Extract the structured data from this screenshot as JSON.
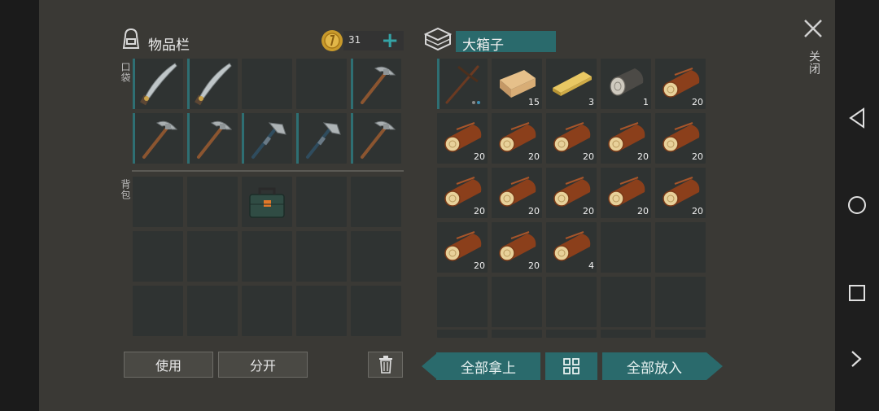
{
  "inventory": {
    "title": "物品栏",
    "pocket_label": "口袋",
    "backpack_label": "背包",
    "coins": "31",
    "add_symbol": "+"
  },
  "chest": {
    "title": "大箱子"
  },
  "pocket_slots": [
    {
      "item": "machete",
      "count": ""
    },
    {
      "item": "machete",
      "count": ""
    },
    {
      "item": "empty",
      "count": ""
    },
    {
      "item": "empty",
      "count": ""
    },
    {
      "item": "pickaxe",
      "count": ""
    },
    {
      "item": "pickaxe",
      "count": ""
    },
    {
      "item": "pickaxe",
      "count": ""
    },
    {
      "item": "hatchet",
      "count": ""
    },
    {
      "item": "hatchet",
      "count": ""
    },
    {
      "item": "pickaxe",
      "count": ""
    }
  ],
  "backpack_slots": [
    {
      "item": "empty"
    },
    {
      "item": "empty"
    },
    {
      "item": "toolbox"
    },
    {
      "item": "empty"
    },
    {
      "item": "empty"
    },
    {
      "item": "empty"
    },
    {
      "item": "empty"
    },
    {
      "item": "empty"
    },
    {
      "item": "empty"
    },
    {
      "item": "empty"
    },
    {
      "item": "empty"
    },
    {
      "item": "empty"
    },
    {
      "item": "empty"
    },
    {
      "item": "empty"
    },
    {
      "item": "empty"
    }
  ],
  "chest_slots": [
    {
      "item": "crowbar-pickaxe",
      "count": ""
    },
    {
      "item": "wooden-plank",
      "count": "15"
    },
    {
      "item": "board",
      "count": "3"
    },
    {
      "item": "gray-log",
      "count": "1"
    },
    {
      "item": "log",
      "count": "20"
    },
    {
      "item": "log",
      "count": "20"
    },
    {
      "item": "log",
      "count": "20"
    },
    {
      "item": "log",
      "count": "20"
    },
    {
      "item": "log",
      "count": "20"
    },
    {
      "item": "log",
      "count": "20"
    },
    {
      "item": "log",
      "count": "20"
    },
    {
      "item": "log",
      "count": "20"
    },
    {
      "item": "log",
      "count": "20"
    },
    {
      "item": "log",
      "count": "20"
    },
    {
      "item": "log",
      "count": "20"
    },
    {
      "item": "log",
      "count": "20"
    },
    {
      "item": "log",
      "count": "20"
    },
    {
      "item": "log",
      "count": "4"
    },
    {
      "item": "empty",
      "count": ""
    },
    {
      "item": "empty",
      "count": ""
    },
    {
      "item": "empty",
      "count": ""
    },
    {
      "item": "empty",
      "count": ""
    },
    {
      "item": "empty",
      "count": ""
    },
    {
      "item": "empty",
      "count": ""
    },
    {
      "item": "empty",
      "count": ""
    }
  ],
  "buttons": {
    "use": "使用",
    "split": "分开",
    "take_all": "全部拿上",
    "put_all": "全部放入",
    "close": "关闭"
  },
  "colors": {
    "accent": "#2a6a6c",
    "panel": "#3a3935",
    "slot": "#2f3332"
  }
}
